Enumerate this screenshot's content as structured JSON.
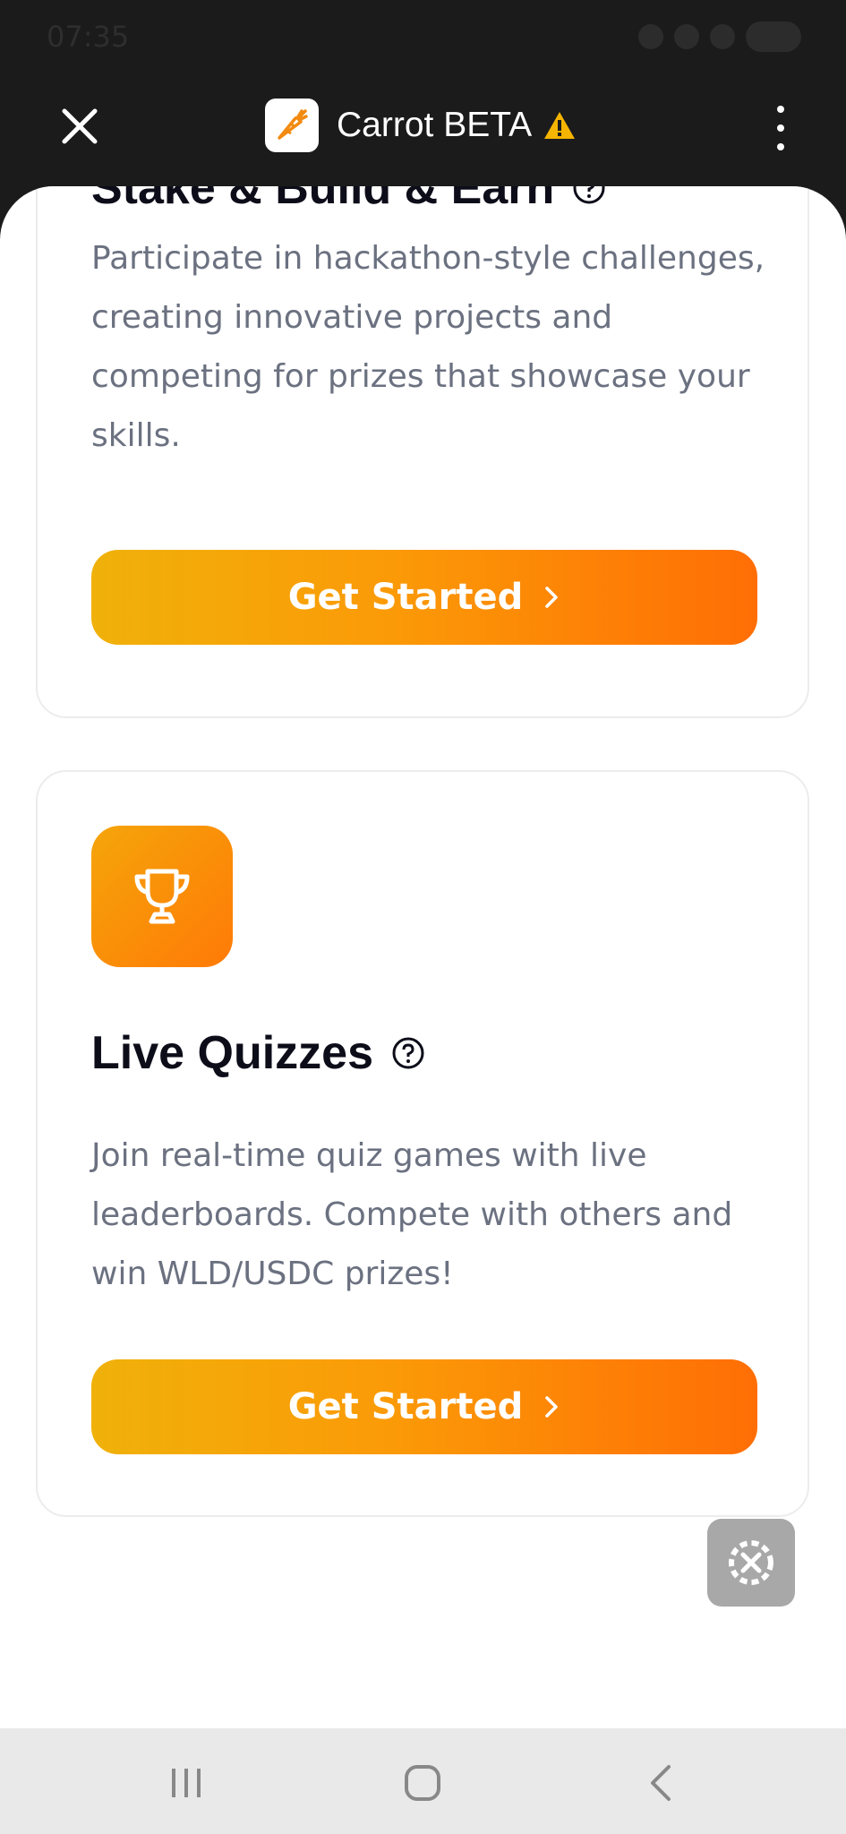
{
  "status_bar": {
    "time": "07:35"
  },
  "header": {
    "app_name": "Carrot BETA"
  },
  "cards": [
    {
      "title": "Stake & Build & Earn",
      "description": "Participate in hackathon-style challenges, creating innovative projects and competing for prizes that showcase your skills.",
      "button_label": "Get Started"
    },
    {
      "title": "Live Quizzes",
      "description": "Join real-time quiz games with live leaderboards. Compete with others and win WLD/USDC prizes!",
      "button_label": "Get Started"
    }
  ],
  "colors": {
    "accent_start": "#f0b10a",
    "accent_end": "#ff6e05",
    "warning": "#f5b400"
  }
}
